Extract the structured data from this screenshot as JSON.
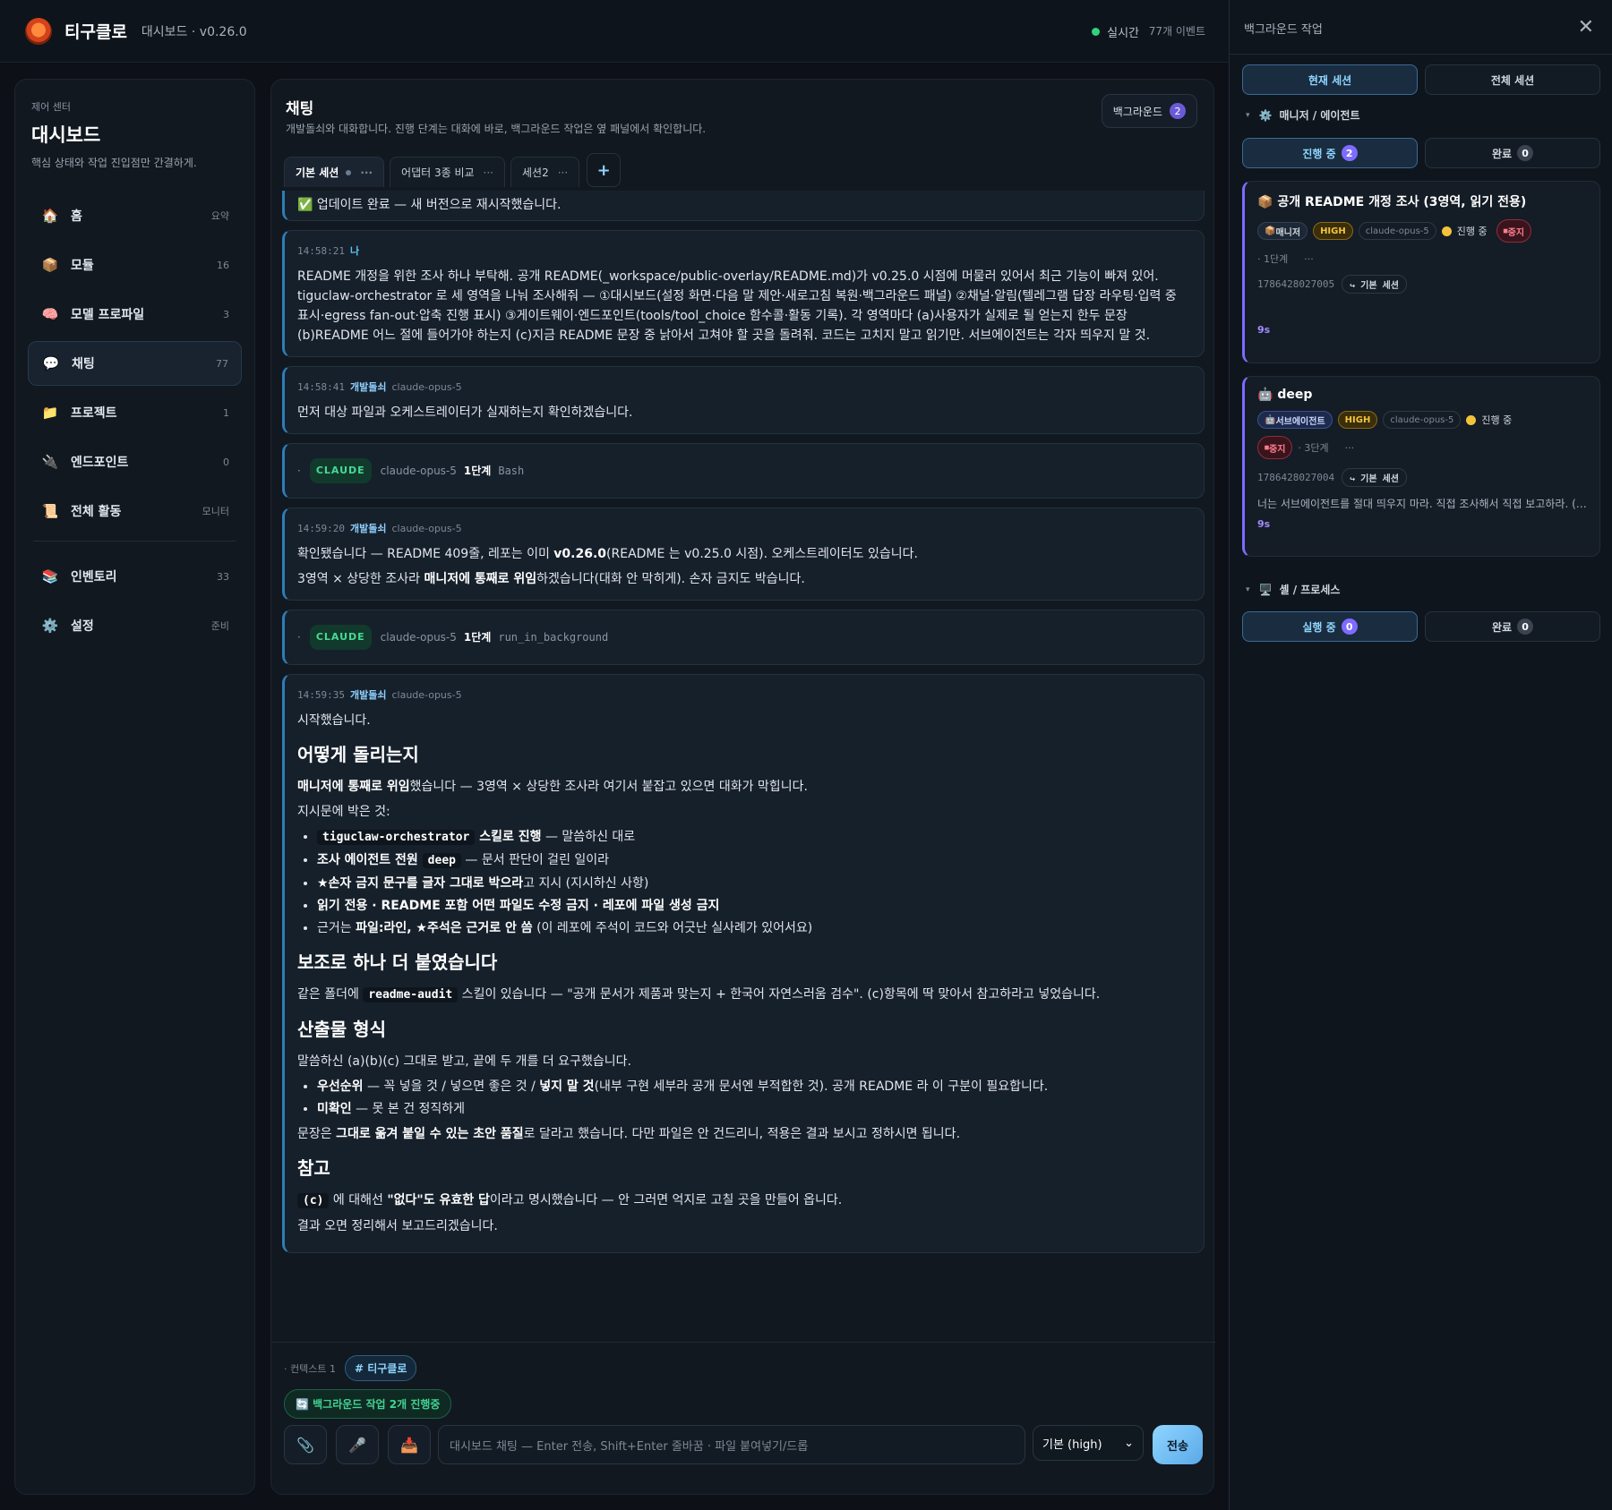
{
  "header": {
    "brand": "티구클로",
    "version": "대시보드 · v0.26.0",
    "live_label": "실시간",
    "events_label": "77개 이벤트"
  },
  "sidebar": {
    "subtitle": "제어 센터",
    "title": "대시보드",
    "description": "핵심 상태와 작업 진입점만 간결하게.",
    "items": [
      {
        "label": "홈",
        "count": "요약",
        "icon": "🏠"
      },
      {
        "label": "모듈",
        "count": "16",
        "icon": "📦"
      },
      {
        "label": "모델 프로파일",
        "count": "3",
        "icon": "🧠"
      },
      {
        "label": "채팅",
        "count": "77",
        "icon": "💬"
      },
      {
        "label": "프로젝트",
        "count": "1",
        "icon": "📁"
      },
      {
        "label": "엔드포인트",
        "count": "0",
        "icon": "🔌"
      },
      {
        "label": "전체 활동",
        "count": "모니터",
        "icon": "📜"
      },
      {
        "label": "인벤토리",
        "count": "33",
        "icon": "📚"
      },
      {
        "label": "설정",
        "count": "준비",
        "icon": "⚙️"
      }
    ]
  },
  "chat": {
    "title": "채팅",
    "description": "개발돌쇠와 대화합니다. 진행 단계는 대화에 바로, 백그라운드 작업은 옆 패널에서 확인합니다.",
    "background_button": "백그라운드",
    "background_count": "2",
    "tabs": [
      {
        "label": "기본 세션"
      },
      {
        "label": "어댑터 3종 비교"
      },
      {
        "label": "세션2"
      }
    ],
    "tab_more": "···",
    "tab_add": "+",
    "messages": {
      "update": "✅ 업데이트 완료 — 새 버전으로 재시작했습니다.",
      "m1": {
        "time": "14:58:21",
        "who": "나",
        "text": "README 개정을 위한 조사 하나 부탁해. 공개 README(_workspace/public-overlay/README.md)가 v0.25.0 시점에 머물러 있어서 최근 기능이 빠져 있어. tiguclaw-orchestrator 로 세 영역을 나눠 조사해줘 — ①대시보드(설정 화면·다음 말 제안·새로고침 복원·백그라운드 패널) ②채널·알림(텔레그램 답장 라우팅·입력 중 표시·egress fan-out·압축 진행 표시) ③게이트웨이·엔드포인트(tools/tool_choice 함수콜·활동 기록). 각 영역마다 (a)사용자가 실제로 될 얻는지 한두 문장 (b)README 어느 절에 들어가야 하는지 (c)지금 README 문장 중 낡아서 고쳐야 할 곳을 돌려줘. 코드는 고치지 말고 읽기만. 서브에이전트는 각자 띄우지 말 것."
      },
      "m2": {
        "time": "14:58:41",
        "who": "개발돌쇠",
        "model": "claude-opus-5",
        "text": "먼저 대상 파일과 오케스트레이터가 실재하는지 확인하겠습니다."
      },
      "t1": {
        "tag": "CLAUDE",
        "model": "claude-opus-5",
        "stage": "1단계",
        "tool": "Bash"
      },
      "m3": {
        "time": "14:59:20",
        "who": "개발돌쇠",
        "model": "claude-opus-5",
        "line1_a": "확인됐습니다 — README 409줄, 레포는 이미 ",
        "line1_b": "v0.26.0",
        "line1_c": "(README 는 v0.25.0 시점). 오케스트레이터도 있습니다.",
        "line2_a": "3영역 × 상당한 조사라 ",
        "line2_b": "매니저에 통째로 위임",
        "line2_c": "하겠습니다(대화 안 막히게). 손자 금지도 박습니다."
      },
      "t2": {
        "tag": "CLAUDE",
        "model": "claude-opus-5",
        "stage": "1단계",
        "tool": "run_in_background"
      },
      "m4": {
        "time": "14:59:35",
        "who": "개발돌쇠",
        "model": "claude-opus-5",
        "intro": "시작했습니다.",
        "h1": "어떻게 돌리는지",
        "p1_b": "매니저에 통째로 위임",
        "p1_c": "했습니다 — 3영역 × 상당한 조사라 여기서 붙잡고 있으면 대화가 막힙니다.",
        "p2": "지시문에 박은 것:",
        "li1_code": "tiguclaw-orchestrator",
        "li1_b": " 스킬로 진행",
        "li1_c": " — 말씀하신 대로",
        "li2_b": "조사 에이전트 전원 ",
        "li2_code": "deep",
        "li2_c": " — 문서 판단이 걸린 일이라",
        "li3_b": "★손자 금지 문구를 글자 그대로 박으라",
        "li3_c": "고 지시 (지시하신 사항)",
        "li4_b": "읽기 전용 · README 포함 어떤 파일도 수정 금지 · 레포에 파일 생성 금지",
        "li5_a": "근거는 ",
        "li5_b": "파일:라인, ★주석은 근거로 안 씀",
        "li5_c": " (이 레포에 주석이 코드와 어긋난 실사례가 있어서요)",
        "h2": "보조로 하나 더 붙였습니다",
        "p3_a": "같은 폴더에 ",
        "p3_code": "readme-audit",
        "p3_c": " 스킬이 있습니다 — \"공개 문서가 제품과 맞는지 + 한국어 자연스러움 검수\". (c)항목에 딱 맞아서 참고하라고 넣었습니다.",
        "h3": "산출물 형식",
        "p4": "말씀하신 (a)(b)(c) 그대로 받고, 끝에 두 개를 더 요구했습니다.",
        "li6_b": "우선순위",
        "li6_c": " — 꼭 넣을 것 / 넣으면 좋은 것 / ",
        "li6_d": "넣지 말 것",
        "li6_e": "(내부 구현 세부라 공개 문서엔 부적합한 것). 공개 README 라 이 구분이 필요합니다.",
        "li7_b": "미확인",
        "li7_c": " — 못 본 건 정직하게",
        "p5_a": "문장은 ",
        "p5_b": "그대로 옮겨 붙일 수 있는 초안 품질",
        "p5_c": "로 달라고 했습니다. 다만 파일은 안 건드리니, 적용은 결과 보시고 정하시면 됩니다.",
        "h4": "참고",
        "p6_code": "(c)",
        "p6_a": " 에 대해선 ",
        "p6_b": "\"없다\"도 유효한 답",
        "p6_c": "이라고 명시했습니다 — 안 그러면 억지로 고칠 곳을 만들어 옵니다.",
        "p7": "결과 오면 정리해서 보고드리겠습니다."
      }
    },
    "composer": {
      "context_label": "· 컨텍스트 1",
      "context_chip": "# 티구클로",
      "bg_running": "백그라운드 작업 2개 진행중",
      "placeholder": "대시보드 채팅 — Enter 전송, Shift+Enter 줄바꿈 · 파일 붙여넣기/드롭",
      "select_value": "기본 (high)",
      "send": "전송"
    }
  },
  "rpanel": {
    "title": "백그라운드 작업",
    "close": "✕",
    "scope_current": "현재 세션",
    "scope_all": "전체 세션",
    "section1": "매니저 / 에이전트",
    "running": "진행 중",
    "running_count": "2",
    "done": "완료",
    "done_count": "0",
    "cards": [
      {
        "title": "공개 README 개정 조사 (3영역, 읽기 전용)",
        "role": "매니저",
        "priority": "HIGH",
        "model": "claude-opus-5",
        "status": "진행 중",
        "stop": "중지",
        "stage": "· 1단계",
        "id": "1786428027005",
        "session": "↪ 기본 세션",
        "duration": "9s"
      },
      {
        "title": "deep",
        "role": "서브에이전트",
        "priority": "HIGH",
        "model": "claude-opus-5",
        "status": "진행 중",
        "stop": "중지",
        "stage": "· 3단계",
        "id": "1786428027004",
        "session": "↪ 기본 세션",
        "desc": "너는 서브에이전트를 절대 띄우지 마라. 직접 조사해서 직접 보고하라. (열...",
        "duration": "9s"
      }
    ],
    "section2": "셸 / 프로세스",
    "shell_running": "실행 중",
    "shell_running_count": "0",
    "shell_done": "완료",
    "shell_done_count": "0"
  }
}
